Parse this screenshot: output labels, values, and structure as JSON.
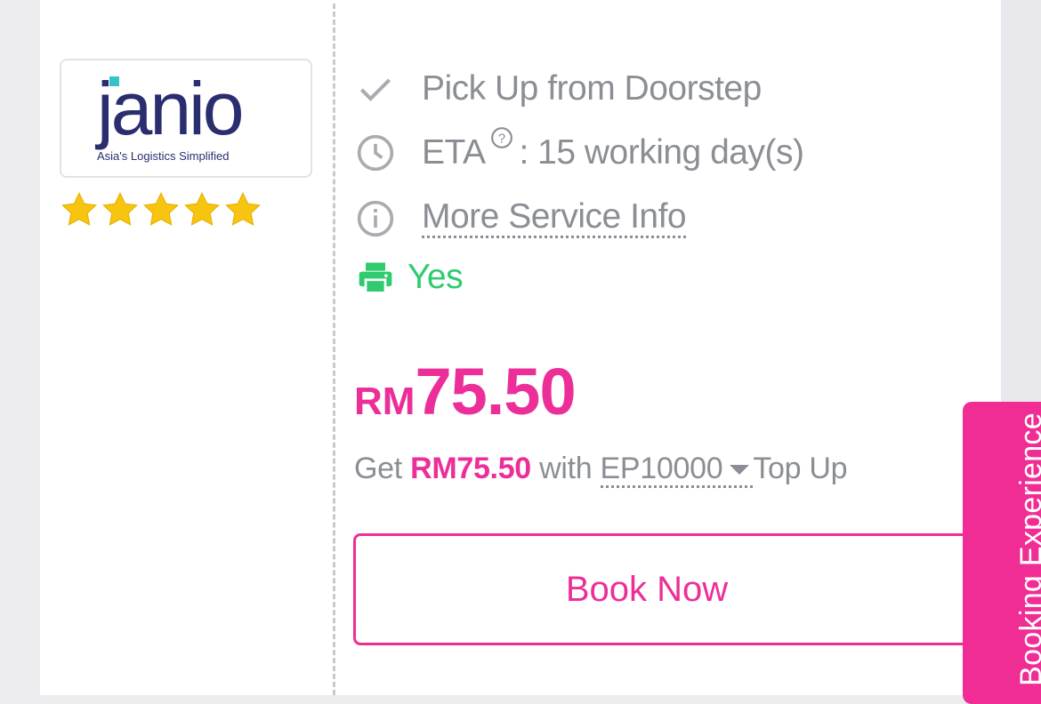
{
  "provider": {
    "logo_text": "janio",
    "logo_tagline": "Asia's Logistics Simplified",
    "rating_stars": 5,
    "rating_max": 5
  },
  "features": {
    "pickup": "Pick Up from Doorstep",
    "eta_label": "ETA",
    "eta_help_icon": "?",
    "eta_value": ": 15 working day(s)",
    "more_info": "More Service Info",
    "print_label": "Yes"
  },
  "price": {
    "currency": "RM",
    "amount": "75.50"
  },
  "topup": {
    "prefix": "Get",
    "discounted_price": "RM75.50",
    "with": "with",
    "selected_plan": "EP10000",
    "suffix": "Top Up"
  },
  "actions": {
    "book_now": "Book Now"
  },
  "feedback_tab": {
    "label": "Booking Experience"
  },
  "colors": {
    "accent": "#ec2f98",
    "text_muted": "#8b8e94",
    "success": "#2fcb6e",
    "logo_navy": "#2a2d6e",
    "logo_teal": "#34c3c9",
    "star": "#f7c40f"
  },
  "icons": [
    "check-icon",
    "clock-icon",
    "help-icon",
    "info-icon",
    "printer-icon",
    "star-icon",
    "caret-down-icon"
  ]
}
